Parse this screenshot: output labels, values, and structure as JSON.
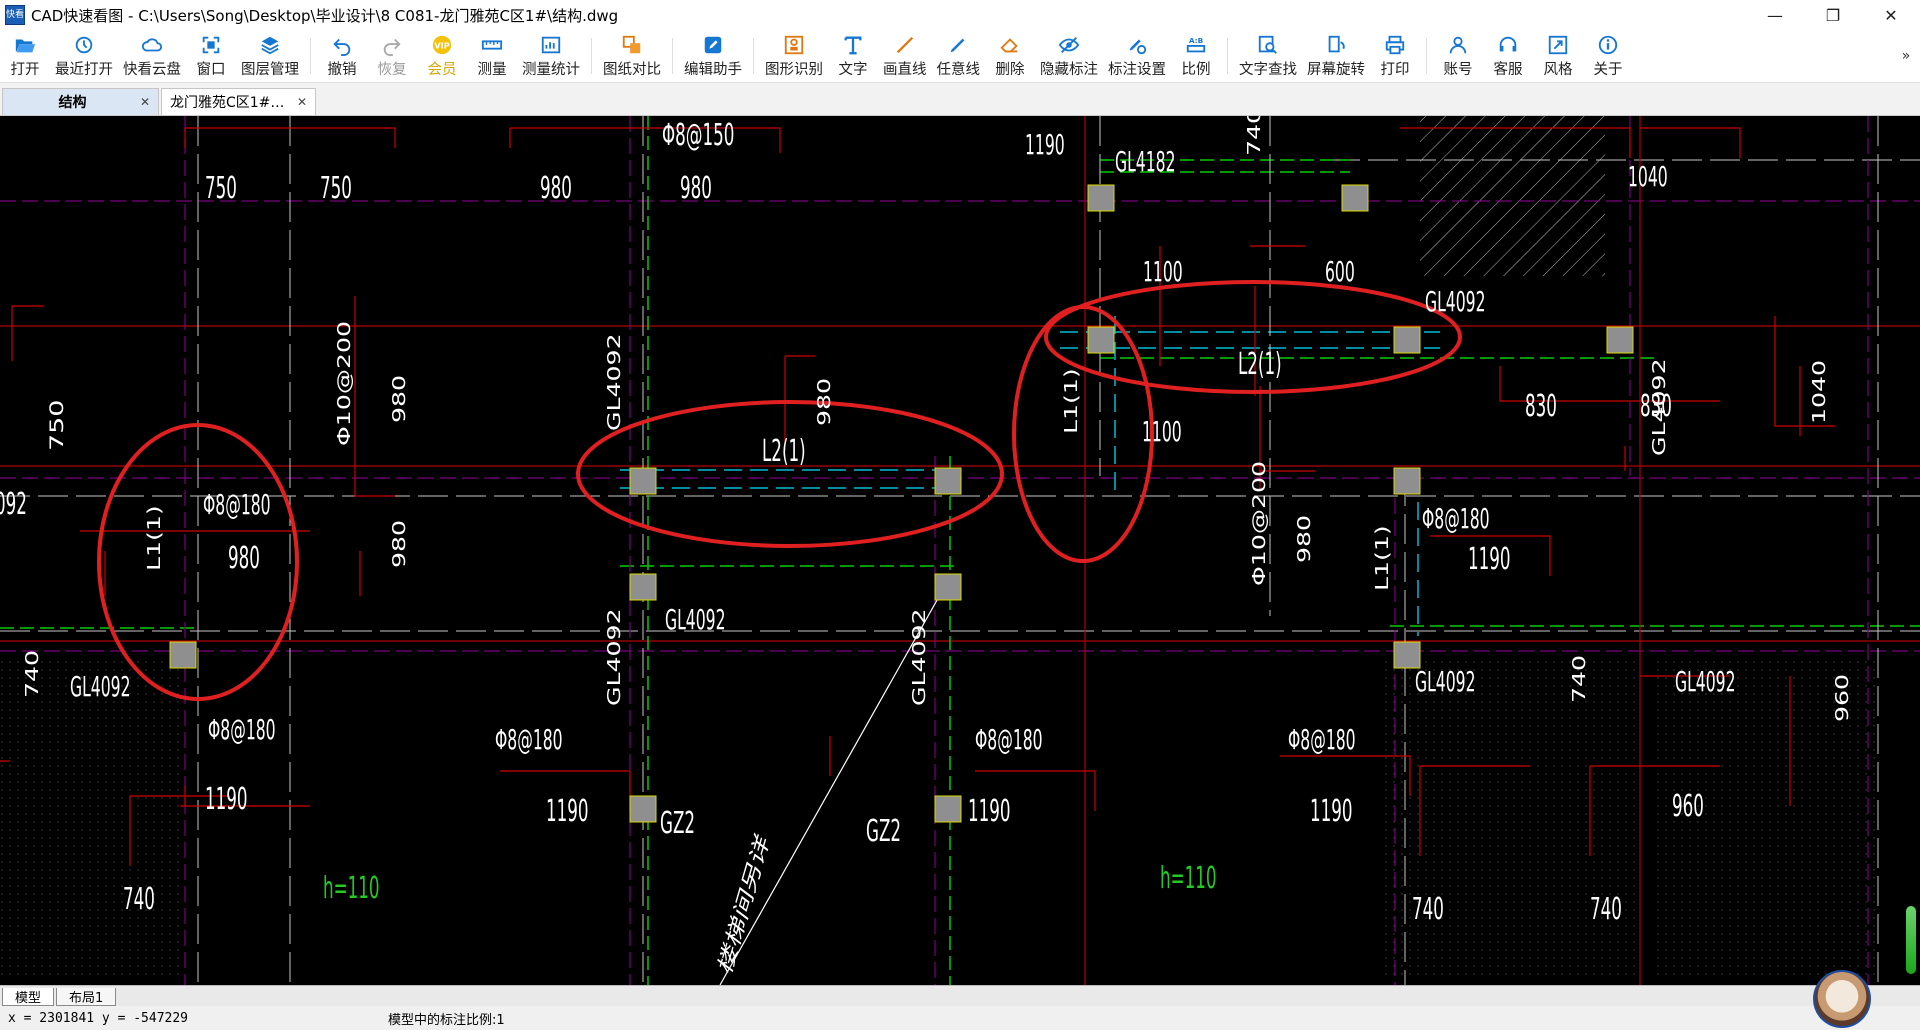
{
  "window": {
    "app_icon_text": "快看",
    "title": "CAD快速看图 - C:\\Users\\Song\\Desktop\\毕业设计\\8 C081-龙门雅苑C区1#\\结构.dwg",
    "minimize": "—",
    "maximize": "❐",
    "close": "✕"
  },
  "toolbar": {
    "items": [
      {
        "label": "打开",
        "icon": "folder-open-icon"
      },
      {
        "label": "最近打开",
        "icon": "clock-icon"
      },
      {
        "label": "快看云盘",
        "icon": "cloud-icon"
      },
      {
        "label": "窗口",
        "icon": "window-icon"
      },
      {
        "label": "图层管理",
        "icon": "layers-icon"
      },
      {
        "label": "撤销",
        "icon": "undo-icon"
      },
      {
        "label": "恢复",
        "icon": "redo-icon"
      },
      {
        "label": "会员",
        "icon": "vip-icon"
      },
      {
        "label": "测量",
        "icon": "ruler-icon"
      },
      {
        "label": "测量统计",
        "icon": "measure-stats-icon"
      },
      {
        "label": "图纸对比",
        "icon": "compare-icon"
      },
      {
        "label": "编辑助手",
        "icon": "edit-assistant-icon"
      },
      {
        "label": "图形识别",
        "icon": "shape-recognition-icon"
      },
      {
        "label": "文字",
        "icon": "text-icon"
      },
      {
        "label": "画直线",
        "icon": "line-icon"
      },
      {
        "label": "任意线",
        "icon": "freehand-icon"
      },
      {
        "label": "删除",
        "icon": "eraser-icon"
      },
      {
        "label": "隐藏标注",
        "icon": "eye-hide-icon"
      },
      {
        "label": "标注设置",
        "icon": "annotation-settings-icon"
      },
      {
        "label": "比例",
        "icon": "scale-icon"
      },
      {
        "label": "文字查找",
        "icon": "text-search-icon"
      },
      {
        "label": "屏幕旋转",
        "icon": "rotate-screen-icon"
      },
      {
        "label": "打印",
        "icon": "printer-icon"
      },
      {
        "label": "账号",
        "icon": "user-icon"
      },
      {
        "label": "客服",
        "icon": "headset-icon"
      },
      {
        "label": "风格",
        "icon": "style-icon"
      },
      {
        "label": "关于",
        "icon": "info-icon"
      }
    ],
    "more": "»"
  },
  "tabs": [
    {
      "label": "结构",
      "close": "✕",
      "active": true
    },
    {
      "label": "龙门雅苑C区1#…",
      "close": "✕",
      "active": false
    }
  ],
  "drawing": {
    "texts": [
      {
        "t": "Φ8@150",
        "c": "#ffffff"
      },
      {
        "t": "1190",
        "c": "#ffffff"
      },
      {
        "t": "GL4182",
        "c": "#ffffff"
      },
      {
        "t": "740",
        "c": "#ffffff"
      },
      {
        "t": "1040",
        "c": "#ffffff"
      },
      {
        "t": "750",
        "c": "#ffffff"
      },
      {
        "t": "750",
        "c": "#ffffff"
      },
      {
        "t": "980",
        "c": "#ffffff"
      },
      {
        "t": "980",
        "c": "#ffffff"
      },
      {
        "t": "1100",
        "c": "#ffffff"
      },
      {
        "t": "600",
        "c": "#ffffff"
      },
      {
        "t": "GL4092",
        "c": "#ffffff"
      },
      {
        "t": "L2(1)",
        "c": "#ffffff"
      },
      {
        "t": "830",
        "c": "#ffffff"
      },
      {
        "t": "830",
        "c": "#ffffff"
      },
      {
        "t": "1040",
        "c": "#ffffff"
      },
      {
        "t": "GL4092",
        "c": "#ffffff"
      },
      {
        "t": "750",
        "c": "#ffffff"
      },
      {
        "t": "Φ10@200",
        "c": "#ffffff"
      },
      {
        "t": "980",
        "c": "#ffffff"
      },
      {
        "t": "GL4092",
        "c": "#ffffff"
      },
      {
        "t": "980",
        "c": "#ffffff"
      },
      {
        "t": "L2(1)",
        "c": "#ffffff"
      },
      {
        "t": "L1(1)",
        "c": "#ffffff"
      },
      {
        "t": "1100",
        "c": "#ffffff"
      },
      {
        "t": "092",
        "c": "#ffffff"
      },
      {
        "t": "Φ8@180",
        "c": "#ffffff"
      },
      {
        "t": "L1(1)",
        "c": "#ffffff"
      },
      {
        "t": "980",
        "c": "#ffffff"
      },
      {
        "t": "980",
        "c": "#ffffff"
      },
      {
        "t": "Φ8@180",
        "c": "#ffffff"
      },
      {
        "t": "Φ10@200",
        "c": "#ffffff"
      },
      {
        "t": "980",
        "c": "#ffffff"
      },
      {
        "t": "1190",
        "c": "#ffffff"
      },
      {
        "t": "L1(1)",
        "c": "#ffffff"
      },
      {
        "t": "GL4092",
        "c": "#ffffff"
      },
      {
        "t": "GL4092",
        "c": "#ffffff"
      },
      {
        "t": "740",
        "c": "#ffffff"
      },
      {
        "t": "GL4092",
        "c": "#ffffff"
      },
      {
        "t": "GL4092",
        "c": "#ffffff"
      },
      {
        "t": "GL4092",
        "c": "#ffffff"
      },
      {
        "t": "740",
        "c": "#ffffff"
      },
      {
        "t": "GL4092",
        "c": "#ffffff"
      },
      {
        "t": "960",
        "c": "#ffffff"
      },
      {
        "t": "Φ8@180",
        "c": "#ffffff"
      },
      {
        "t": "Φ8@180",
        "c": "#ffffff"
      },
      {
        "t": "Φ8@180",
        "c": "#ffffff"
      },
      {
        "t": "Φ8@180",
        "c": "#ffffff"
      },
      {
        "t": "1190",
        "c": "#ffffff"
      },
      {
        "t": "1190",
        "c": "#ffffff"
      },
      {
        "t": "GZ2",
        "c": "#ffffff"
      },
      {
        "t": "GZ2",
        "c": "#ffffff"
      },
      {
        "t": "1190",
        "c": "#ffffff"
      },
      {
        "t": "1190",
        "c": "#ffffff"
      },
      {
        "t": "960",
        "c": "#ffffff"
      },
      {
        "t": "h=110",
        "c": "#22cc22"
      },
      {
        "t": "h=110",
        "c": "#22cc22"
      },
      {
        "t": "740",
        "c": "#ffffff"
      },
      {
        "t": "740",
        "c": "#ffffff"
      },
      {
        "t": "740",
        "c": "#ffffff"
      },
      {
        "t": "楼梯间另详",
        "c": "#ffffff"
      }
    ]
  },
  "sheet_tabs": [
    {
      "label": "模型",
      "active": true
    },
    {
      "label": "布局1",
      "active": false
    }
  ],
  "status": {
    "coords": "x = 2301841  y = -547229",
    "scale_text": "模型中的标注比例:1"
  }
}
